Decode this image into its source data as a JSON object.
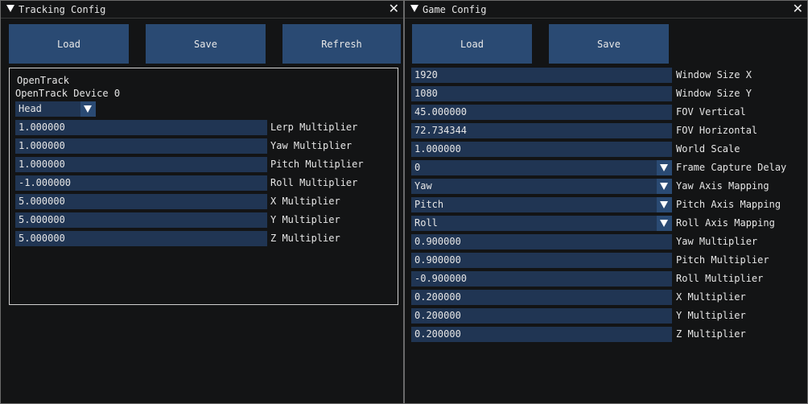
{
  "tracking": {
    "title": "Tracking Config",
    "buttons": {
      "load": "Load",
      "save": "Save",
      "refresh": "Refresh"
    },
    "source_name": "OpenTrack",
    "device_name": "OpenTrack Device 0",
    "body_part": "Head",
    "fields": [
      {
        "value": "1.000000",
        "label": "Lerp Multiplier"
      },
      {
        "value": "1.000000",
        "label": "Yaw Multiplier"
      },
      {
        "value": "1.000000",
        "label": "Pitch Multiplier"
      },
      {
        "value": "-1.000000",
        "label": "Roll Multiplier"
      },
      {
        "value": "5.000000",
        "label": "X Multiplier"
      },
      {
        "value": "5.000000",
        "label": "Y Multiplier"
      },
      {
        "value": "5.000000",
        "label": "Z Multiplier"
      }
    ]
  },
  "game": {
    "title": "Game Config",
    "buttons": {
      "load": "Load",
      "save": "Save"
    },
    "fields": [
      {
        "value": "1920",
        "label": "Window Size X"
      },
      {
        "value": "1080",
        "label": "Window Size Y"
      },
      {
        "value": "45.000000",
        "label": "FOV Vertical"
      },
      {
        "value": "72.734344",
        "label": "FOV Horizontal"
      },
      {
        "value": "1.000000",
        "label": "World Scale"
      },
      {
        "value": "0",
        "label": "Frame Capture Delay"
      },
      {
        "value": "Yaw",
        "label": "Yaw Axis Mapping"
      },
      {
        "value": "Pitch",
        "label": "Pitch Axis Mapping"
      },
      {
        "value": "Roll",
        "label": "Roll Axis Mapping"
      },
      {
        "value": "0.900000",
        "label": "Yaw Multiplier"
      },
      {
        "value": "0.900000",
        "label": "Pitch Multiplier"
      },
      {
        "value": "-0.900000",
        "label": "Roll Multiplier"
      },
      {
        "value": "0.200000",
        "label": "X Multiplier"
      },
      {
        "value": "0.200000",
        "label": "Y Multiplier"
      },
      {
        "value": "0.200000",
        "label": "Z Multiplier"
      }
    ]
  },
  "icons": {
    "collapse": "collapse-triangle-icon",
    "close": "close-icon",
    "dropdown": "chevron-down-icon"
  },
  "colors": {
    "window_bg": "#131415",
    "button": "#2a4a73",
    "field": "#203553",
    "border": "#d0d0d0"
  }
}
